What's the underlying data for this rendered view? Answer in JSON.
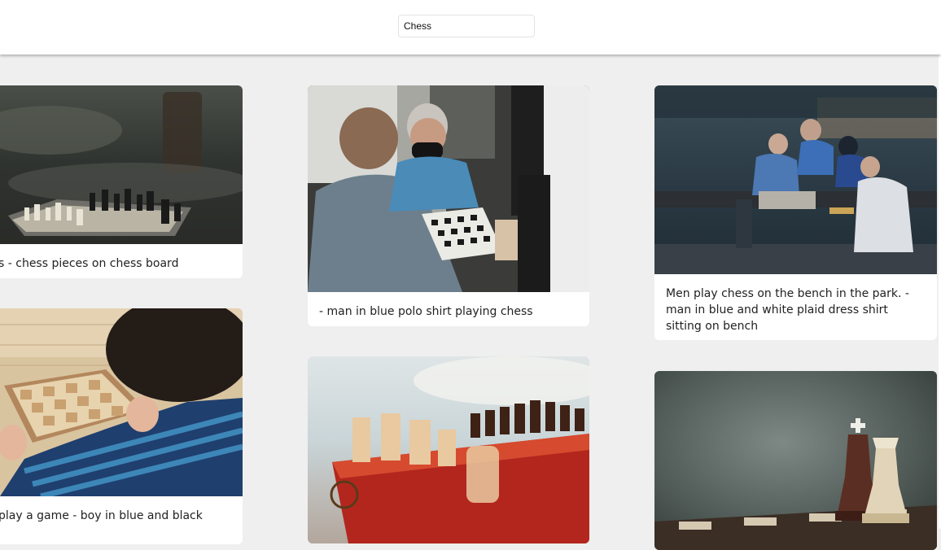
{
  "search": {
    "value": "Chess"
  },
  "cards": [
    {
      "caption": "s - chess pieces on chess board",
      "image": "chess-pieces-on-board-photo"
    },
    {
      "caption": "- man in blue polo shirt playing chess",
      "image": "men-playing-chess-street-photo"
    },
    {
      "caption": "Men play chess on the bench in the park. - man in blue and white plaid dress shirt sitting on bench",
      "image": "men-chess-park-bench-photo"
    },
    {
      "caption": "play a game - boy in blue and black",
      "image": "boy-with-chessboard-photo"
    },
    {
      "caption": "",
      "image": "chess-pieces-closeup-photo"
    },
    {
      "caption": "",
      "image": "king-and-queen-pieces-photo"
    }
  ],
  "colors": {
    "page_background": "#efefef",
    "card_background": "#ffffff",
    "caption_text": "#222222"
  }
}
